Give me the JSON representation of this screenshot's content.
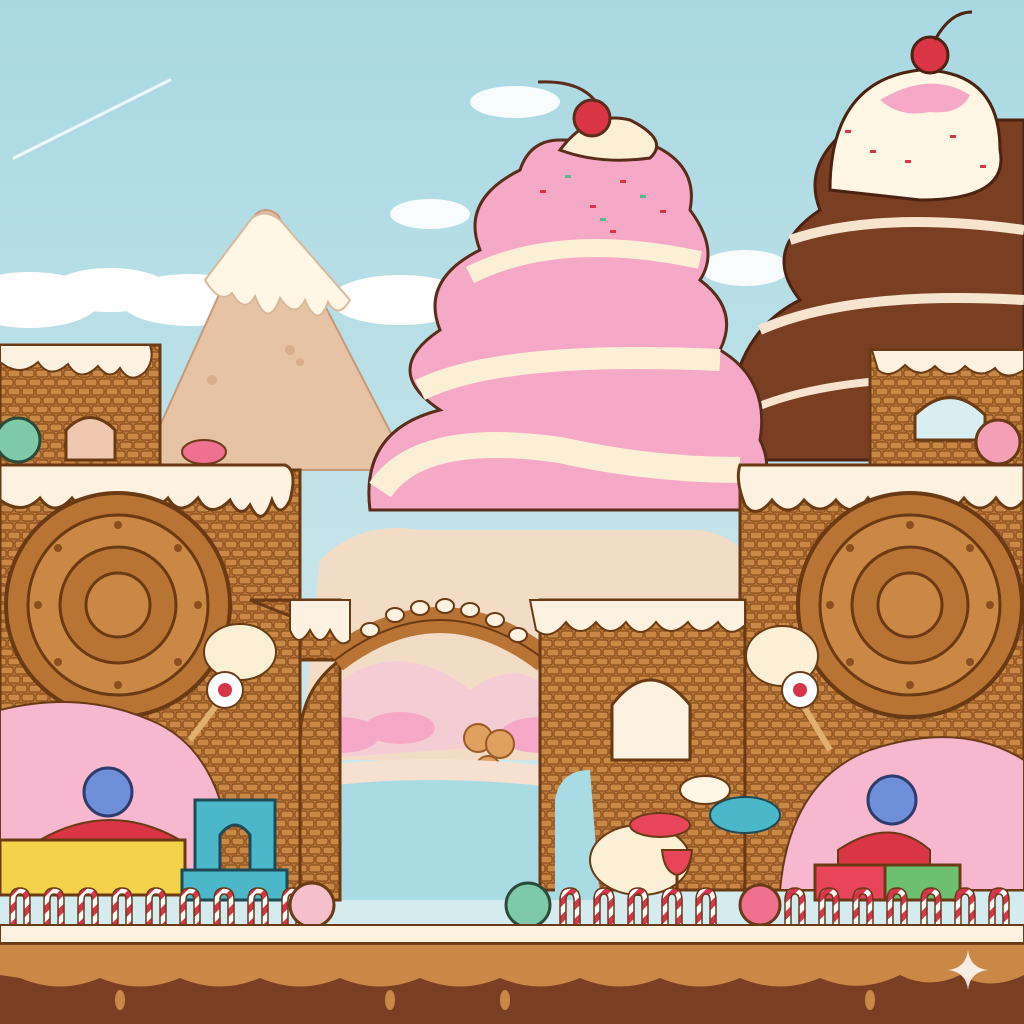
{
  "scene": {
    "kind": "candy-land side-scrolling game level",
    "colors": {
      "sky_top": "#a9d8e3",
      "sky_bottom": "#d9eef0",
      "cloud": "#ffffff",
      "mountain": "#e6c3a4",
      "mountain_snow": "#fff6e4",
      "cream": "#fbf0d6",
      "pink_cream": "#f6a9c6",
      "chocolate": "#7a3e22",
      "cookie": "#b87434",
      "cookie_dark": "#8a4e1f",
      "frosting": "#fdf2e0",
      "river": "#a9dbe4",
      "cherry": "#d93545",
      "candy_cane_red": "#d8344a"
    }
  }
}
